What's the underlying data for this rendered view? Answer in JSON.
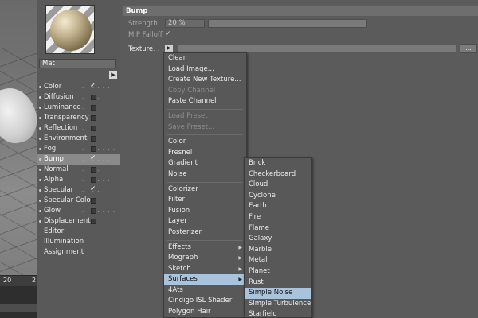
{
  "viewport": {
    "ruler": [
      "20",
      "2"
    ]
  },
  "material": {
    "name": "Mat",
    "channels": [
      {
        "label": "Color",
        "dots": ". . . . . .",
        "checked": true,
        "bullet": true
      },
      {
        "label": "Diffusion",
        "dots": ". . . .",
        "checked": false,
        "bullet": true
      },
      {
        "label": "Luminance",
        "dots": ". .",
        "checked": false,
        "bullet": true
      },
      {
        "label": "Transparency",
        "dots": "",
        "checked": false,
        "bullet": true
      },
      {
        "label": "Reflection",
        "dots": ". . .",
        "checked": false,
        "bullet": true
      },
      {
        "label": "Environment",
        "dots": "",
        "checked": false,
        "bullet": true
      },
      {
        "label": "Fog",
        "dots": ". . . . . . . .",
        "checked": false,
        "bullet": true
      },
      {
        "label": "Bump",
        "dots": ". . . . . .",
        "checked": true,
        "bullet": true,
        "active": true
      },
      {
        "label": "Normal",
        "dots": ". . . .",
        "checked": false,
        "bullet": true
      },
      {
        "label": "Alpha",
        "dots": ". . . . . .",
        "checked": false,
        "bullet": true
      },
      {
        "label": "Specular",
        "dots": ". . . .",
        "checked": true,
        "bullet": true
      },
      {
        "label": "Specular Color",
        "dots": "",
        "checked": false,
        "bullet": true
      },
      {
        "label": "Glow",
        "dots": ". . . . . . .",
        "checked": false,
        "bullet": true
      },
      {
        "label": "Displacement",
        "dots": "",
        "checked": false,
        "bullet": true
      }
    ],
    "extra_items": [
      "Editor",
      "Illumination",
      "Assignment"
    ]
  },
  "bump": {
    "header": "Bump",
    "strength_label": "Strength",
    "strength_value": "20 %",
    "strength_fraction": 0.0,
    "mip_label": "MIP Falloff",
    "mip_checked": "✓",
    "texture_label": "Texture",
    "texture_dots": ". . .",
    "more_button": "..."
  },
  "menu": {
    "items": [
      {
        "label": "Clear"
      },
      {
        "label": "Load Image..."
      },
      {
        "label": "Create New Texture..."
      },
      {
        "label": "Copy Channel",
        "disabled": true
      },
      {
        "label": "Paste Channel"
      },
      {
        "sep": true
      },
      {
        "label": "Load Preset",
        "disabled": true
      },
      {
        "label": "Save Preset...",
        "disabled": true
      },
      {
        "sep": true
      },
      {
        "label": "Color"
      },
      {
        "label": "Fresnel"
      },
      {
        "label": "Gradient"
      },
      {
        "label": "Noise"
      },
      {
        "sep": true
      },
      {
        "label": "Colorizer"
      },
      {
        "label": "Filter"
      },
      {
        "label": "Fusion"
      },
      {
        "label": "Layer"
      },
      {
        "label": "Posterizer"
      },
      {
        "sep": true
      },
      {
        "label": "Effects",
        "submenu": true
      },
      {
        "label": "Mograph",
        "submenu": true
      },
      {
        "label": "Sketch",
        "submenu": true
      },
      {
        "label": "Surfaces",
        "submenu": true,
        "highlight": true
      },
      {
        "label": "4Ats"
      },
      {
        "label": "Cindigo ISL Shader"
      },
      {
        "label": "Polygon Hair"
      }
    ]
  },
  "submenu": {
    "items": [
      {
        "label": "Brick"
      },
      {
        "label": "Checkerboard"
      },
      {
        "label": "Cloud"
      },
      {
        "label": "Cyclone"
      },
      {
        "label": "Earth"
      },
      {
        "label": "Fire"
      },
      {
        "label": "Flame"
      },
      {
        "label": "Galaxy"
      },
      {
        "label": "Marble"
      },
      {
        "label": "Metal"
      },
      {
        "label": "Planet"
      },
      {
        "label": "Rust"
      },
      {
        "label": "Simple Noise",
        "highlight": true
      },
      {
        "label": "Simple Turbulence"
      },
      {
        "label": "Starfield"
      }
    ]
  },
  "colors": {
    "highlight": "#a9c3dc",
    "panel": "#5b5b5b",
    "active_channel": "#8a8a8a"
  }
}
